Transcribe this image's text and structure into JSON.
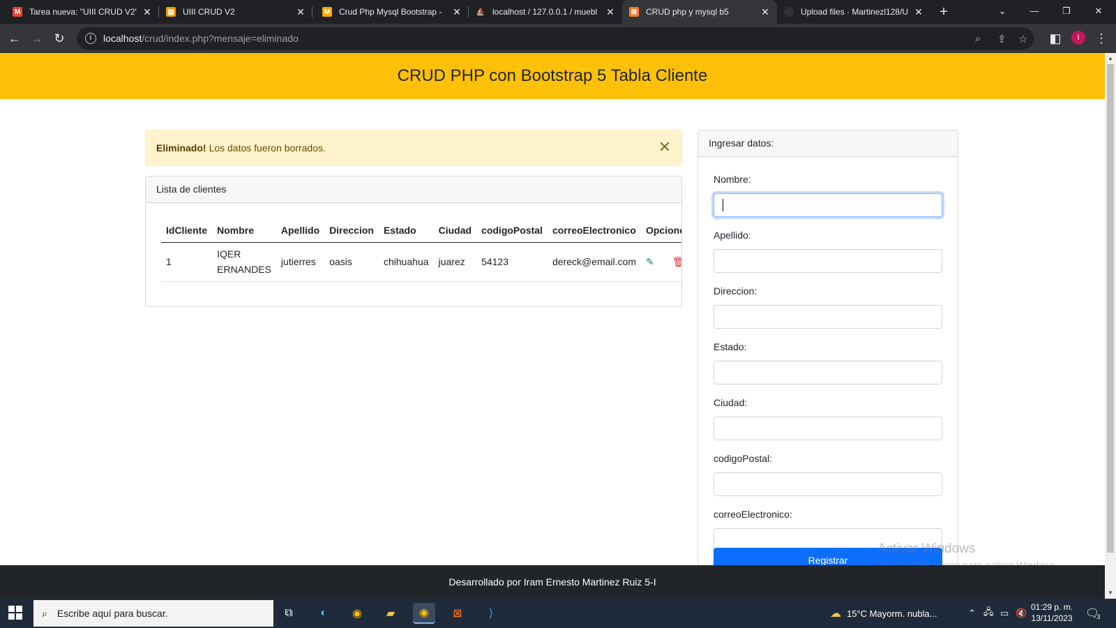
{
  "browser": {
    "tabs": [
      {
        "title": "Tarea nueva: \"UIII CRUD V2\"",
        "favicon": "gmail-icon",
        "color": "#ea4335"
      },
      {
        "title": "UIII CRUD V2",
        "favicon": "classroom-icon",
        "color": "#f29900"
      },
      {
        "title": "Crud Php Mysql Bootstrap - ",
        "favicon": "youtube-icon",
        "color": "#f9ab00"
      },
      {
        "title": "localhost / 127.0.0.1 / muebl",
        "favicon": "phpmyadmin-icon",
        "color": "#f29900"
      },
      {
        "title": "CRUD php y mysql b5",
        "favicon": "xampp-icon",
        "color": "#fb7a24"
      },
      {
        "title": "Upload files · Martinezl128/U",
        "favicon": "github-icon",
        "color": "#303134"
      }
    ],
    "active_tab": 4,
    "url_host": "localhost",
    "url_path": "/crud/index.php?mensaje=eliminado",
    "profile_initial": "I"
  },
  "page": {
    "header_title": "CRUD PHP con Bootstrap 5 Tabla Cliente",
    "alert": {
      "strong": "Eliminado!",
      "text": "Los datos fueron borrados."
    },
    "list_card_title": "Lista de clientes",
    "table": {
      "columns": [
        "IdCliente",
        "Nombre",
        "Apellido",
        "Direccion",
        "Estado",
        "Ciudad",
        "codigoPostal",
        "correoElectronico",
        "Opciones"
      ],
      "rows": [
        {
          "id": "1",
          "nombre": "IQER ERNANDES",
          "apellido": "jutierres",
          "direccion": "oasis",
          "estado": "chihuahua",
          "ciudad": "juarez",
          "cp": "54123",
          "correo": "dereck@email.com"
        }
      ]
    },
    "form": {
      "title": "Ingresar datos:",
      "fields": [
        "Nombre:",
        "Apellido:",
        "Direccion:",
        "Estado:",
        "Ciudad:",
        "codigoPostal:",
        "correoElectronico:"
      ],
      "submit_label": "Registrar"
    },
    "footer": "Desarrollado por Iram Ernesto Martinez Ruiz 5-I",
    "watermark": {
      "line1": "Activar Windows",
      "line2": "Ve a Configuración para activar Windows."
    }
  },
  "taskbar": {
    "search_placeholder": "Escribe aquí para buscar.",
    "weather": "15°C  Mayorm. nubla...",
    "time": "01:29 p. m.",
    "date": "13/11/2023",
    "notification_count": "3"
  },
  "colors": {
    "header": "#ffc107",
    "alert_bg": "#fff3cd",
    "primary": "#0d6efd",
    "footer": "#212529"
  }
}
